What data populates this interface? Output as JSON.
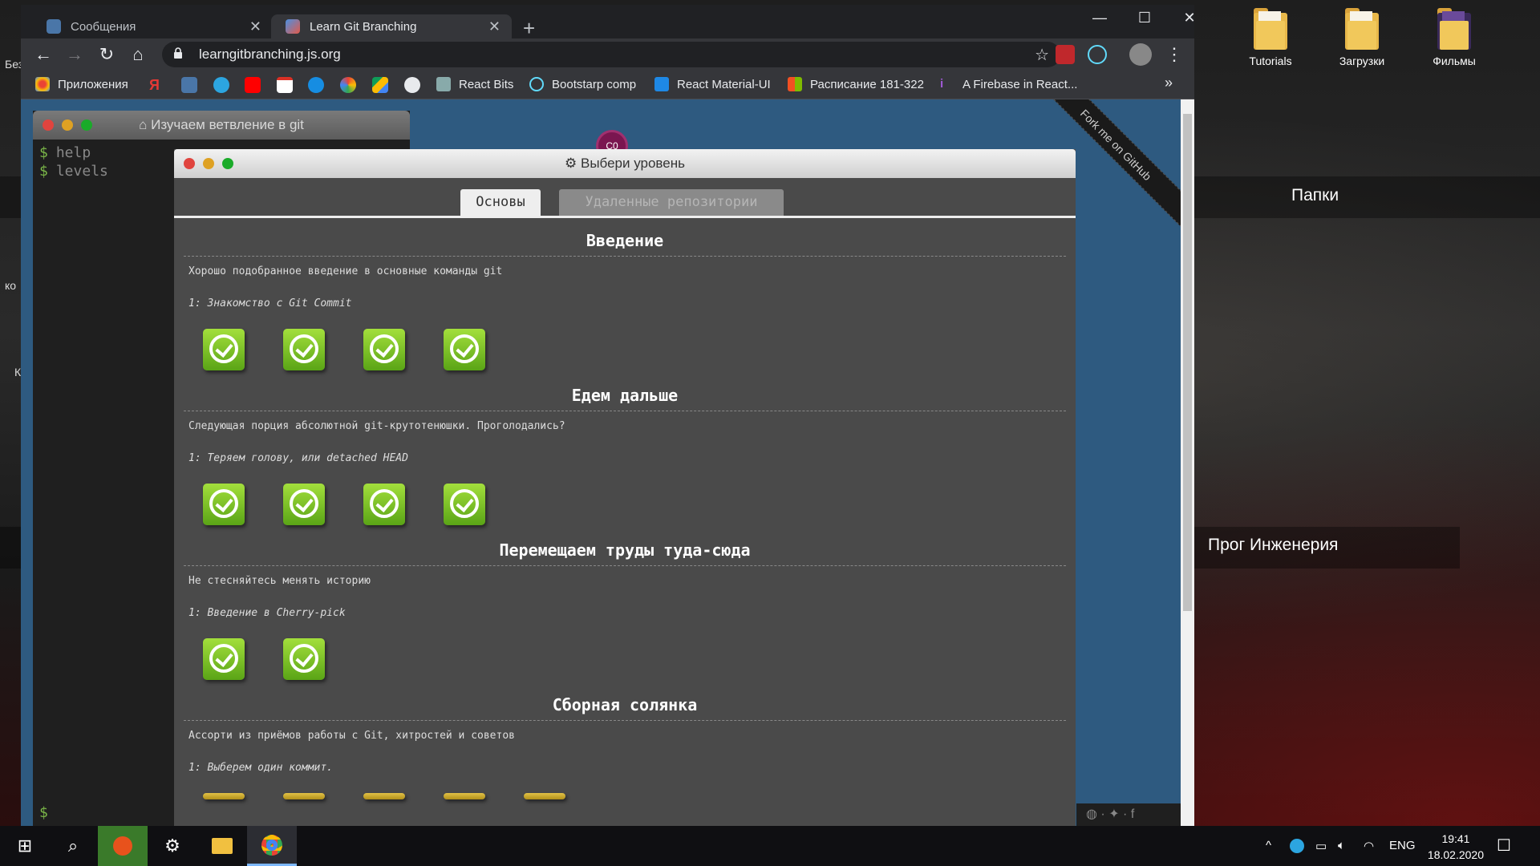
{
  "desktop": {
    "icons": [
      {
        "label": "Tutorials"
      },
      {
        "label": "Загрузки"
      },
      {
        "label": "Фильмы"
      }
    ],
    "groups": [
      "Папки",
      "Прог Инженерия"
    ],
    "left_peek": [
      "Без",
      "ко",
      "К"
    ]
  },
  "browser": {
    "tabs": [
      {
        "title": "Сообщения",
        "active": false
      },
      {
        "title": "Learn Git Branching",
        "active": true
      }
    ],
    "new_tab": "+",
    "url": "learngitbranching.js.org",
    "bookmarks": [
      {
        "label": "Приложения"
      },
      {
        "label": "React Bits"
      },
      {
        "label": "Bootstarp comp"
      },
      {
        "label": "React Material-UI"
      },
      {
        "label": "Расписание 181-322"
      },
      {
        "label": "A Firebase in React..."
      }
    ],
    "overflow": "»"
  },
  "page": {
    "ribbon": "Fork me on GitHub",
    "commit_label": "C0",
    "terminal": {
      "title": "Изучаем ветвление в git",
      "lines": [
        "help",
        "levels"
      ],
      "prompt": "$"
    },
    "dialog": {
      "title": "Выбери уровень",
      "tabs": [
        "Основы",
        "Удаленные репозитории"
      ],
      "sequences": [
        {
          "title": "Введение",
          "desc": "Хорошо подобранное введение в основные команды git",
          "sub": "1: Знакомство с Git Commit",
          "count": 4
        },
        {
          "title": "Едем дальше",
          "desc": "Следующая порция абсолютной git-крутотенюшки. Проголодались?",
          "sub": "1: Теряем голову, или detached HEAD",
          "count": 4
        },
        {
          "title": "Перемещаем труды туда-сюда",
          "desc": "Не стесняйтесь менять историю",
          "sub": "1: Введение в Cherry-pick",
          "count": 2
        },
        {
          "title": "Сборная солянка",
          "desc": "Ассорти из приёмов работы с Git, хитростей и советов",
          "sub": "1: Выберем один коммит.",
          "count": 5
        }
      ]
    }
  },
  "taskbar": {
    "lang": "ENG",
    "time": "19:41",
    "date": "18.02.2020"
  }
}
